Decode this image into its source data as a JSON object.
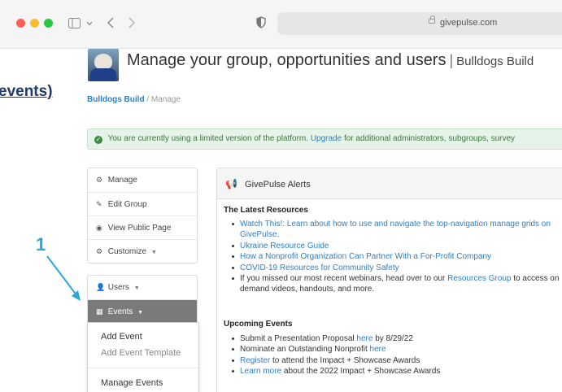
{
  "browser": {
    "url": "givepulse.com",
    "window_controls": [
      "close",
      "minimize",
      "zoom"
    ],
    "icons": [
      "sidebar-icon",
      "chevron-down-icon",
      "back-icon",
      "forward-icon",
      "shield-icon",
      "lock-icon"
    ]
  },
  "annotations": {
    "events_label": "events)",
    "step_number": "1"
  },
  "header": {
    "title": "Manage your group, opportunities and users",
    "separator": "|",
    "org_name": "Bulldogs Build",
    "breadcrumb_link": "Bulldogs Build",
    "breadcrumb_sep": "/",
    "breadcrumb_current": "Manage"
  },
  "notice": {
    "text_before": "You are currently using a limited version of the platform.",
    "link": "Upgrade",
    "text_after": "for additional administrators, subgroups, survey"
  },
  "sidebar": {
    "group1": [
      {
        "label": "Manage",
        "icon": "cogs-icon"
      },
      {
        "label": "Edit Group",
        "icon": "pencil-icon"
      },
      {
        "label": "View Public Page",
        "icon": "eye-icon"
      },
      {
        "label": "Customize",
        "icon": "cogs-icon"
      }
    ],
    "group2": [
      {
        "label": "Users",
        "icon": "user-icon"
      },
      {
        "label": "Events",
        "icon": "calendar-icon",
        "active": true
      }
    ],
    "dropdown": [
      "Add Event",
      "Add Event Template",
      "Manage Events"
    ]
  },
  "alerts": {
    "title": "GivePulse Alerts",
    "latest_title": "The Latest Resources",
    "latest": [
      {
        "link": "Watch This!: Learn about how to use and navigate the top-navigation manage grids on GivePulse."
      },
      {
        "link": "Ukraine Resource Guide"
      },
      {
        "link": "How a Nonprofit Organization Can Partner With a For-Profit Company"
      },
      {
        "link": "COVID-19 Resources for Community Safety"
      },
      {
        "before": "If you missed our most recent webinars, head over to our",
        "link": "Resources Group",
        "after": "to access on demand videos, handouts, and more."
      }
    ],
    "upcoming_title": "Upcoming Events",
    "upcoming": [
      {
        "before": "Submit a Presentation Proposal",
        "link": "here",
        "after": "by 8/29/22"
      },
      {
        "before": "Nominate an Outstanding Nonprofit",
        "link": "here",
        "after": ""
      },
      {
        "before": "",
        "link": "Register",
        "after": "to attend the Impact + Showcase Awards"
      },
      {
        "before": "",
        "link": "Learn more",
        "after": "about the 2022 Impact + Showcase Awards"
      }
    ]
  },
  "colors": {
    "link": "#2f7fbf",
    "active_menu": "#7a7a7a",
    "notice_bg": "#e6f3e8",
    "annotation_blue": "#2aa7d6",
    "annotation_navy": "#1f3a6b"
  }
}
